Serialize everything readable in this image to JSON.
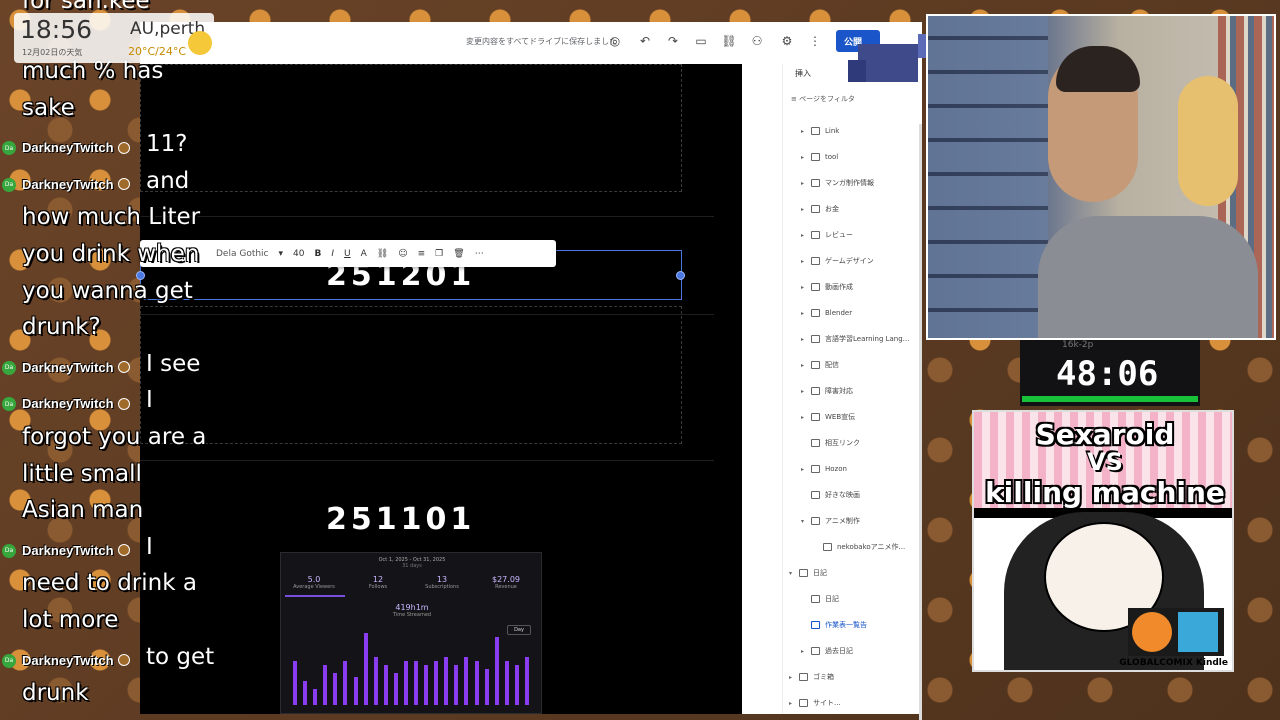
{
  "overlay": {
    "clock": {
      "time": "18:56",
      "location": "AU,perth",
      "date": "12月02日の天気",
      "temperature": "20°C/24°C"
    },
    "chat_top_text": "for san.kee",
    "chat": [
      {
        "type": "text",
        "text": "much % has"
      },
      {
        "type": "text",
        "text": "sake"
      },
      {
        "type": "message",
        "user": "DarkneyTwitch",
        "text": "11?"
      },
      {
        "type": "message",
        "user": "DarkneyTwitch",
        "text": "and"
      },
      {
        "type": "text",
        "text": "how much Liter"
      },
      {
        "type": "text",
        "text": "you drink when"
      },
      {
        "type": "text",
        "text": "you wanna get"
      },
      {
        "type": "text",
        "text": "drunk?"
      },
      {
        "type": "message",
        "user": "DarkneyTwitch",
        "text": "I see"
      },
      {
        "type": "message",
        "user": "DarkneyTwitch",
        "text": "I"
      },
      {
        "type": "text",
        "text": "forgot you are a"
      },
      {
        "type": "text",
        "text": "little small"
      },
      {
        "type": "text",
        "text": "Asian man"
      },
      {
        "type": "message",
        "user": "DarkneyTwitch",
        "text": "I"
      },
      {
        "type": "text",
        "text": "need to drink a"
      },
      {
        "type": "text",
        "text": "lot more"
      },
      {
        "type": "message",
        "user": "DarkneyTwitch",
        "text": "to get"
      },
      {
        "type": "text",
        "text": "drunk"
      }
    ],
    "timer": {
      "label": "16k-2p",
      "value": "48:06",
      "bar_color": "#19c13a"
    },
    "book_cover": {
      "title_line1": "Sexaroid",
      "title_line2": "VS",
      "title_line3": "killing machine",
      "publisher": "GLOBALCOMIX Kindle"
    }
  },
  "editor": {
    "save_status": "変更内容をすべてドライブに保存しました",
    "publish_label": "公開",
    "format_bar": {
      "font": "Dela Gothic",
      "size": "40"
    },
    "text_boxes": [
      {
        "text": "251201"
      },
      {
        "text": "251101"
      }
    ],
    "sidebar": {
      "insert_tab": "挿入",
      "filter_label": "ページをフィルタ",
      "pages": [
        {
          "label": "Link",
          "has_children": true
        },
        {
          "label": "tool",
          "has_children": true
        },
        {
          "label": "マンガ制作情報",
          "has_children": true
        },
        {
          "label": "お金",
          "has_children": true
        },
        {
          "label": "レビュー",
          "has_children": true
        },
        {
          "label": "ゲームデザイン",
          "has_children": true
        },
        {
          "label": "動画作成",
          "has_children": true
        },
        {
          "label": "Blender",
          "has_children": true
        },
        {
          "label": "言語学習Learning Lang...",
          "has_children": true
        },
        {
          "label": "配信",
          "has_children": true
        },
        {
          "label": "障害対応",
          "has_children": true
        },
        {
          "label": "WEB宣伝",
          "has_children": true
        },
        {
          "label": "相互リンク",
          "has_children": false
        },
        {
          "label": "Hozon",
          "has_children": true
        },
        {
          "label": "好きな映画",
          "has_children": false
        },
        {
          "label": "アニメ制作",
          "has_children": true,
          "expanded": true
        },
        {
          "label": "nekobakoアニメ作...",
          "has_children": false,
          "indent": 1
        },
        {
          "label": "日記",
          "has_children": true,
          "expanded": true,
          "indent": -1
        },
        {
          "label": "日記",
          "has_children": false
        },
        {
          "label": "作業表一覧告",
          "has_children": false,
          "active": true
        },
        {
          "label": "過去日記",
          "has_children": true
        },
        {
          "label": "ゴミ箱",
          "has_children": true,
          "indent": -1
        },
        {
          "label": "サイト...",
          "has_children": true,
          "indent": -1
        }
      ]
    },
    "stats": {
      "date_range": "Oct 1, 2025 - Oct 31, 2025",
      "days": "31 days",
      "metrics": [
        {
          "value": "5.0",
          "label": "Average Viewers"
        },
        {
          "value": "12",
          "label": "Follows"
        },
        {
          "value": "13",
          "label": "Subscriptions"
        },
        {
          "value": "$27.09",
          "label": "Revenue"
        }
      ],
      "time_streamed_value": "419h1m",
      "time_streamed_label": "Time Streamed",
      "period_select": "Day",
      "bar_values": [
        0.55,
        0.3,
        0.2,
        0.5,
        0.4,
        0.55,
        0.35,
        0.9,
        0.6,
        0.5,
        0.4,
        0.55,
        0.55,
        0.5,
        0.55,
        0.6,
        0.5,
        0.6,
        0.55,
        0.45,
        0.85,
        0.55,
        0.5,
        0.6
      ],
      "accent_color": "#8a3cf0"
    }
  }
}
